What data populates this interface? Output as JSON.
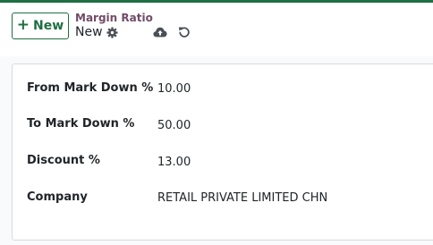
{
  "control_panel": {
    "new_button_label": "New",
    "breadcrumb": "Margin Ratio",
    "record_name": "New"
  },
  "form": {
    "fields": [
      {
        "label": "From Mark Down %",
        "value": "10.00"
      },
      {
        "label": "To Mark Down %",
        "value": "50.00"
      },
      {
        "label": "Discount %",
        "value": "13.00"
      },
      {
        "label": "Company",
        "value": "RETAIL PRIVATE LIMITED CHN"
      }
    ]
  },
  "icons": {
    "new": "plus-icon",
    "actions": "gear-icon",
    "save": "cloud-upload-icon",
    "discard": "undo-icon"
  },
  "colors": {
    "primary": "#1f6f43",
    "breadcrumb": "#714b67",
    "text": "#212529",
    "border": "#d8dadd"
  }
}
